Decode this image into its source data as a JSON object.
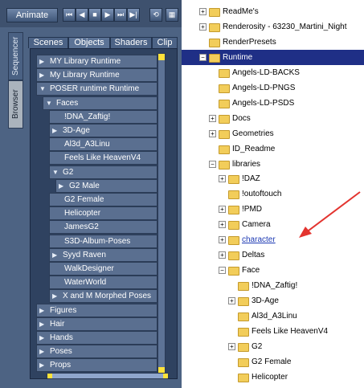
{
  "poser": {
    "toolbar": {
      "animate_label": "Animate",
      "buttons": [
        "⏮",
        "◀",
        "■",
        "▶",
        "⏭",
        "▶|",
        "⟲",
        "▦"
      ]
    },
    "side_tabs": [
      "Sequencer",
      "Browser"
    ],
    "tabs": [
      "Scenes",
      "Objects",
      "Shaders",
      "Clip"
    ],
    "tree": [
      {
        "label": "MY Library Runtime",
        "arrow": "▶"
      },
      {
        "label": "My Library Runtime",
        "arrow": "▶"
      },
      {
        "label": "POSER runtime Runtime",
        "arrow": "▼"
      },
      {
        "label": "Faces",
        "arrow": "▼"
      },
      {
        "label": "!DNA_Zaftig!",
        "arrow": ""
      },
      {
        "label": "3D-Age",
        "arrow": "▶"
      },
      {
        "label": "Al3d_A3Linu",
        "arrow": ""
      },
      {
        "label": "Feels Like HeavenV4",
        "arrow": ""
      },
      {
        "label": "G2",
        "arrow": "▼"
      },
      {
        "label": "G2 Male",
        "arrow": "▶"
      },
      {
        "label": "G2 Female",
        "arrow": ""
      },
      {
        "label": "Helicopter",
        "arrow": ""
      },
      {
        "label": "JamesG2",
        "arrow": ""
      },
      {
        "label": "S3D-Album-Poses",
        "arrow": ""
      },
      {
        "label": "Syyd Raven",
        "arrow": "▶"
      },
      {
        "label": "WalkDesigner",
        "arrow": ""
      },
      {
        "label": "WaterWorld",
        "arrow": ""
      },
      {
        "label": "X and M Morphed Poses",
        "arrow": "▶"
      },
      {
        "label": "Figures",
        "arrow": "▶"
      },
      {
        "label": "Hair",
        "arrow": "▶"
      },
      {
        "label": "Hands",
        "arrow": "▶"
      },
      {
        "label": "Poses",
        "arrow": "▶"
      },
      {
        "label": "Props",
        "arrow": "▶"
      }
    ]
  },
  "explorer": {
    "tree": [
      {
        "label": "ReadMe's",
        "exp": "+"
      },
      {
        "label": "Renderosity - 63230_Martini_Night",
        "exp": "+"
      },
      {
        "label": "RenderPresets",
        "exp": ""
      },
      {
        "label": "Runtime",
        "exp": "−",
        "selected": true
      },
      {
        "label": "Angels-LD-BACKS",
        "exp": ""
      },
      {
        "label": "Angels-LD-PNGS",
        "exp": ""
      },
      {
        "label": "Angels-LD-PSDS",
        "exp": ""
      },
      {
        "label": "Docs",
        "exp": "+"
      },
      {
        "label": "Geometries",
        "exp": "+"
      },
      {
        "label": "ID_Readme",
        "exp": ""
      },
      {
        "label": "libraries",
        "exp": "−"
      },
      {
        "label": "!DAZ",
        "exp": "+"
      },
      {
        "label": "!outoftouch",
        "exp": ""
      },
      {
        "label": "!PMD",
        "exp": "+"
      },
      {
        "label": "Camera",
        "exp": "+"
      },
      {
        "label": "character",
        "exp": "+",
        "link": true
      },
      {
        "label": "Deltas",
        "exp": "+"
      },
      {
        "label": "Face",
        "exp": "−"
      },
      {
        "label": "!DNA_Zaftig!",
        "exp": ""
      },
      {
        "label": "3D-Age",
        "exp": "+"
      },
      {
        "label": "Al3d_A3Linu",
        "exp": ""
      },
      {
        "label": "Feels Like HeavenV4",
        "exp": ""
      },
      {
        "label": "G2",
        "exp": "+"
      },
      {
        "label": "G2 Female",
        "exp": ""
      },
      {
        "label": "Helicopter",
        "exp": ""
      }
    ]
  },
  "colors": {
    "poser_bg": "#4d6383",
    "selection": "#1f2f86",
    "annotation_arrow": "#e3342f",
    "folder": "#f2cd5a"
  }
}
